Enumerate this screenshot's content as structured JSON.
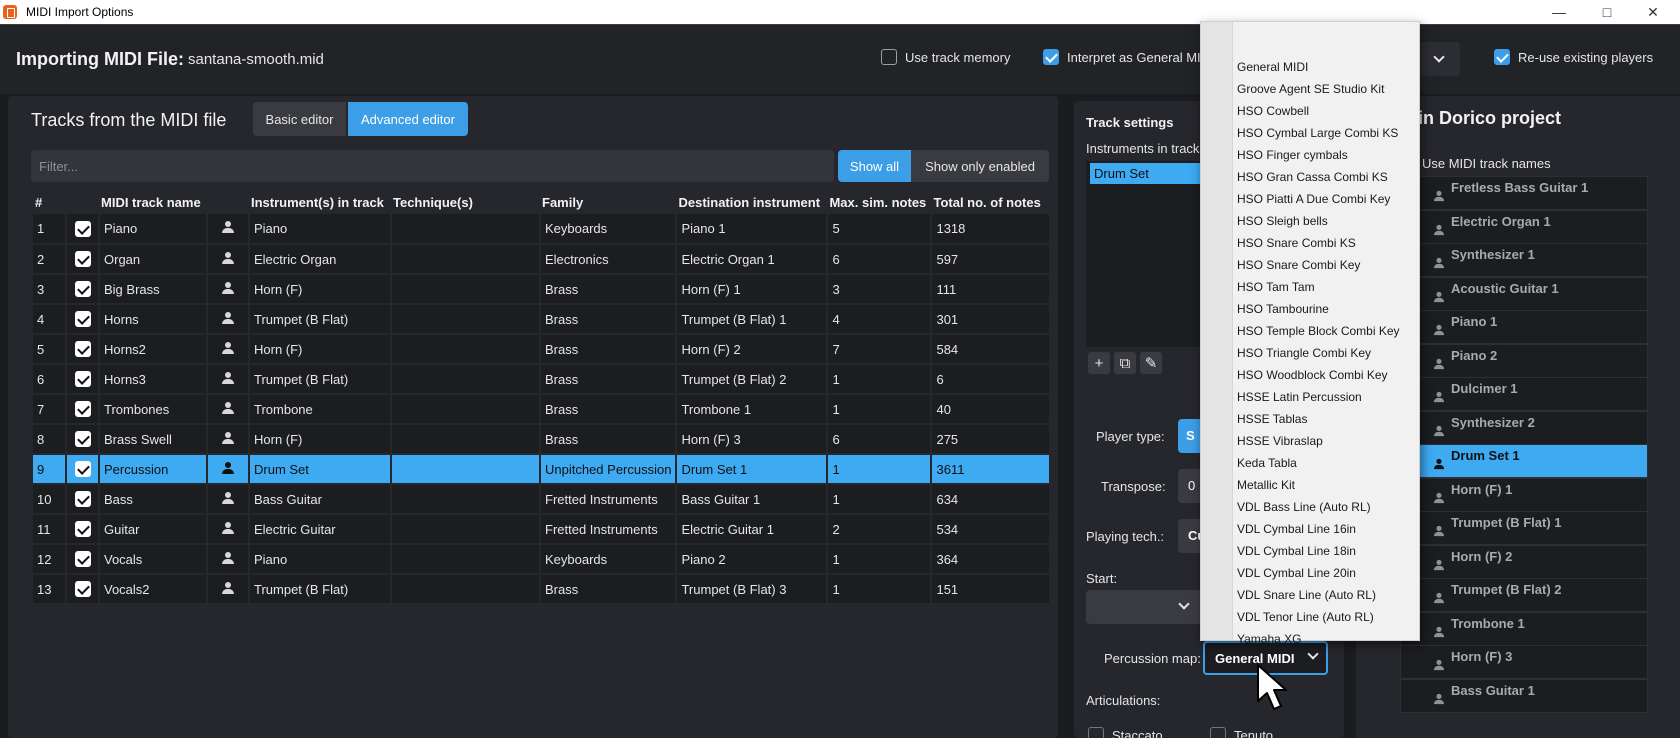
{
  "window": {
    "title": "MIDI Import Options",
    "controls": [
      "—",
      "□",
      "✕"
    ]
  },
  "header": {
    "title": "Importing MIDI File:",
    "filename": "santana-smooth.mid",
    "use_track_memory": {
      "label": "Use track memory",
      "checked": false
    },
    "interpret_gm": {
      "label": "Interpret as General MIDI",
      "checked": true
    },
    "reuse_players": {
      "label": "Re-use existing players",
      "checked": true
    }
  },
  "left_panel": {
    "title": "Tracks from the MIDI file",
    "basic_editor": "Basic editor",
    "advanced_editor": "Advanced editor",
    "filter_placeholder": "Filter...",
    "show_all": "Show all",
    "show_only_enabled": "Show only enabled",
    "columns": [
      "#",
      "MIDI track name",
      "Instrument(s) in track",
      "Technique(s)",
      "Family",
      "Destination instrument",
      "Max. sim. notes",
      "Total no. of notes"
    ],
    "rows": [
      {
        "num": "1",
        "name": "Piano",
        "instrument": "Piano",
        "technique": "",
        "family": "Keyboards",
        "destination": "Piano 1",
        "max_sim": "5",
        "total": "1318"
      },
      {
        "num": "2",
        "name": "Organ",
        "instrument": "Electric Organ",
        "technique": "",
        "family": "Electronics",
        "destination": "Electric Organ 1",
        "max_sim": "6",
        "total": "597"
      },
      {
        "num": "3",
        "name": "Big Brass",
        "instrument": "Horn (F)",
        "technique": "",
        "family": "Brass",
        "destination": "Horn (F) 1",
        "max_sim": "3",
        "total": "111"
      },
      {
        "num": "4",
        "name": "Horns",
        "instrument": "Trumpet (B Flat)",
        "technique": "",
        "family": "Brass",
        "destination": "Trumpet (B Flat) 1",
        "max_sim": "4",
        "total": "301"
      },
      {
        "num": "5",
        "name": "Horns2",
        "instrument": "Horn (F)",
        "technique": "",
        "family": "Brass",
        "destination": "Horn (F) 2",
        "max_sim": "7",
        "total": "584"
      },
      {
        "num": "6",
        "name": "Horns3",
        "instrument": "Trumpet (B Flat)",
        "technique": "",
        "family": "Brass",
        "destination": "Trumpet (B Flat) 2",
        "max_sim": "1",
        "total": "6"
      },
      {
        "num": "7",
        "name": "Trombones",
        "instrument": "Trombone",
        "technique": "",
        "family": "Brass",
        "destination": "Trombone 1",
        "max_sim": "1",
        "total": "40"
      },
      {
        "num": "8",
        "name": "Brass Swell",
        "instrument": "Horn (F)",
        "technique": "",
        "family": "Brass",
        "destination": "Horn (F) 3",
        "max_sim": "6",
        "total": "275"
      },
      {
        "num": "9",
        "name": "Percussion",
        "instrument": "Drum Set",
        "technique": "",
        "family": "Unpitched Percussion",
        "destination": "Drum Set 1",
        "max_sim": "1",
        "total": "3611"
      },
      {
        "num": "10",
        "name": "Bass",
        "instrument": "Bass Guitar",
        "technique": "",
        "family": "Fretted Instruments",
        "destination": "Bass Guitar 1",
        "max_sim": "1",
        "total": "634"
      },
      {
        "num": "11",
        "name": "Guitar",
        "instrument": "Electric Guitar",
        "technique": "",
        "family": "Fretted Instruments",
        "destination": "Electric Guitar 1",
        "max_sim": "2",
        "total": "534"
      },
      {
        "num": "12",
        "name": "Vocals",
        "instrument": "Piano",
        "technique": "",
        "family": "Keyboards",
        "destination": "Piano 2",
        "max_sim": "1",
        "total": "364"
      },
      {
        "num": "13",
        "name": "Vocals2",
        "instrument": "Trumpet (B Flat)",
        "technique": "",
        "family": "Brass",
        "destination": "Trumpet (B Flat) 3",
        "max_sim": "1",
        "total": "151"
      }
    ],
    "selected_row": "9"
  },
  "track_settings": {
    "title": "Track settings",
    "instruments_label": "Instruments in tracks:",
    "instrument_item": "Drum Set",
    "player_type_label": "Player type:",
    "player_type_value": "S",
    "transpose_label": "Transpose:",
    "transpose_value": "0",
    "playing_tech_label": "Playing tech.:",
    "playing_tech_value": "Cu",
    "start_label": "Start:",
    "percussion_map_label": "Percussion map:",
    "percussion_map_value": "General MIDI",
    "articulations_label": "Articulations:",
    "staccato": "Staccato",
    "tenuto": "Tenuto"
  },
  "right_panel": {
    "title": "ers in Dorico project",
    "use_midi_track_names": "Use MIDI track names",
    "players": [
      "Fretless Bass Guitar 1",
      "Electric Organ 1",
      "Synthesizer 1",
      "Acoustic Guitar 1",
      "Piano 1",
      "Piano 2",
      "Dulcimer 1",
      "Synthesizer 2",
      "Drum Set 1",
      "Horn (F) 1",
      "Trumpet (B Flat) 1",
      "Horn (F) 2",
      "Trumpet (B Flat) 2",
      "Trombone 1",
      "Horn (F) 3",
      "Bass Guitar 1"
    ],
    "selected_player": "Drum Set 1"
  },
  "dropdown": {
    "items": [
      "General MIDI",
      "Groove Agent SE Studio Kit",
      "HSO Cowbell",
      "HSO Cymbal Large Combi KS",
      "HSO Finger cymbals",
      "HSO Gran Cassa Combi KS",
      "HSO Piatti A Due Combi Key",
      "HSO Sleigh bells",
      "HSO Snare Combi KS",
      "HSO Snare Combi Key",
      "HSO Tam Tam",
      "HSO Tambourine",
      "HSO Temple Block Combi Key",
      "HSO Triangle Combi Key",
      "HSO Woodblock Combi Key",
      "HSSE Latin Percussion",
      "HSSE Tablas",
      "HSSE Vibraslap",
      "Keda Tabla",
      "Metallic Kit",
      "VDL Bass Line (Auto RL)",
      "VDL Cymbal Line 16in",
      "VDL Cymbal Line 18in",
      "VDL Cymbal Line 20in",
      "VDL Snare Line (Auto RL)",
      "VDL Tenor Line (Auto RL)",
      "Yamaha XG"
    ]
  },
  "colors": {
    "accent": "#3d9ee8",
    "selection": "#3daaf2",
    "background": "#1b1c20",
    "panel": "#26272c"
  }
}
